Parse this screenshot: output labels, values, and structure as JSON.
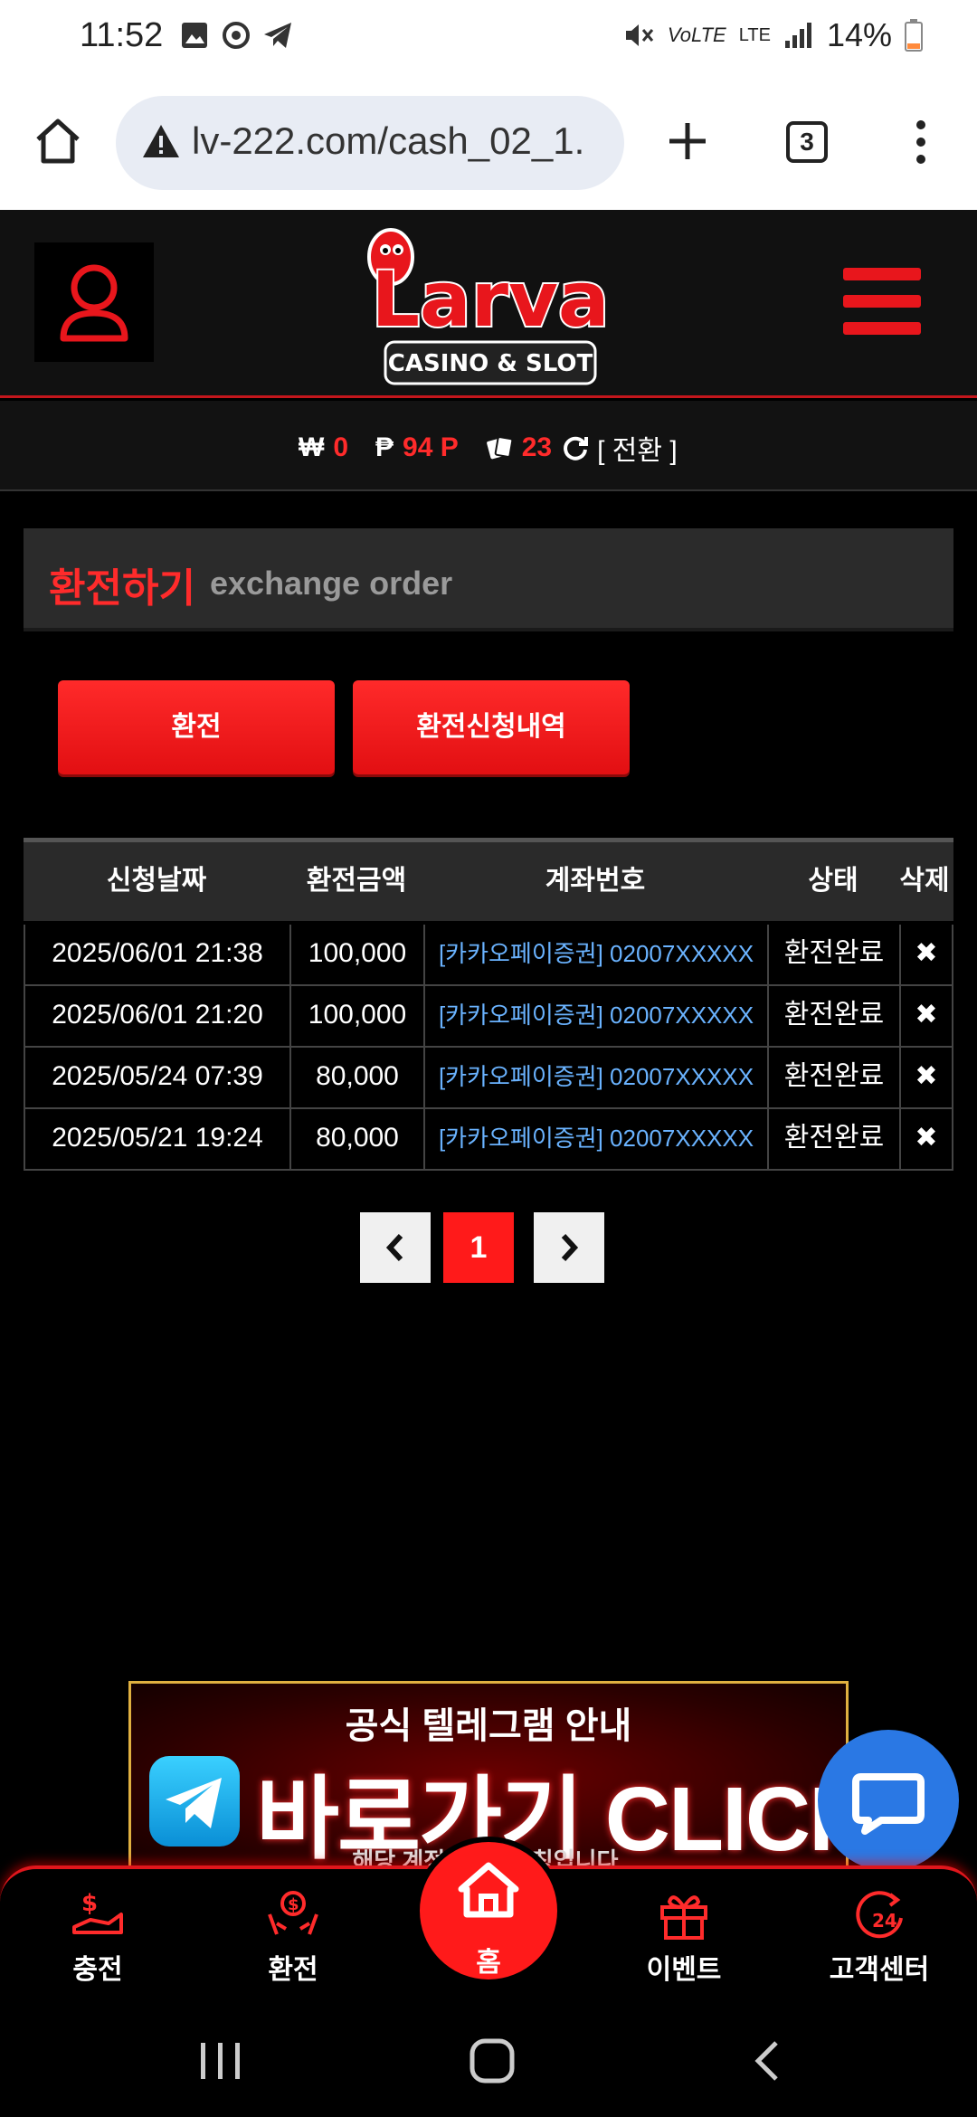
{
  "status_bar": {
    "time": "11:52",
    "battery": "14%",
    "signal_text": "LTE"
  },
  "browser": {
    "url": "lv-222.com/cash_02_1.",
    "tab_count": "3"
  },
  "header": {
    "logo_top": "Larva",
    "logo_bottom": "CASINO & SLOT"
  },
  "balance": {
    "won_symbol": "₩",
    "won_value": "0",
    "point_symbol": "₱",
    "point_value": "94 P",
    "coupon_value": "23",
    "switch_label": "[ 전환 ]"
  },
  "section": {
    "title_ko": "환전하기",
    "title_en": "exchange order"
  },
  "buttons": {
    "exchange": "환전",
    "history": "환전신청내역"
  },
  "table": {
    "headers": [
      "신청날짜",
      "환전금액",
      "계좌번호",
      "상태",
      "삭제"
    ],
    "rows": [
      {
        "date": "2025/06/01 21:38",
        "amount": "100,000",
        "account": "[카카오페이증권] 02007XXXXX",
        "status": "환전완료",
        "delete": "✖"
      },
      {
        "date": "2025/06/01 21:20",
        "amount": "100,000",
        "account": "[카카오페이증권] 02007XXXXX",
        "status": "환전완료",
        "delete": "✖"
      },
      {
        "date": "2025/05/24 07:39",
        "amount": "80,000",
        "account": "[카카오페이증권] 02007XXXXX",
        "status": "환전완료",
        "delete": "✖"
      },
      {
        "date": "2025/05/21 19:24",
        "amount": "80,000",
        "account": "[카카오페이증권] 02007XXXXX",
        "status": "환전완료",
        "delete": "✖"
      }
    ]
  },
  "pagination": {
    "prev": "‹",
    "current": "1",
    "next": "›"
  },
  "banner": {
    "top": "공식 텔레그램 안내",
    "main": "바로가기 CLICK",
    "sub": "해당 계정 외 … 사칭입니다."
  },
  "bottom_nav": {
    "charge": "충전",
    "exchange": "환전",
    "home": "홈",
    "event": "이벤트",
    "support": "고객센터"
  },
  "colors": {
    "accent": "#ff1a1a",
    "link": "#6ab3ff",
    "bg": "#000000"
  }
}
